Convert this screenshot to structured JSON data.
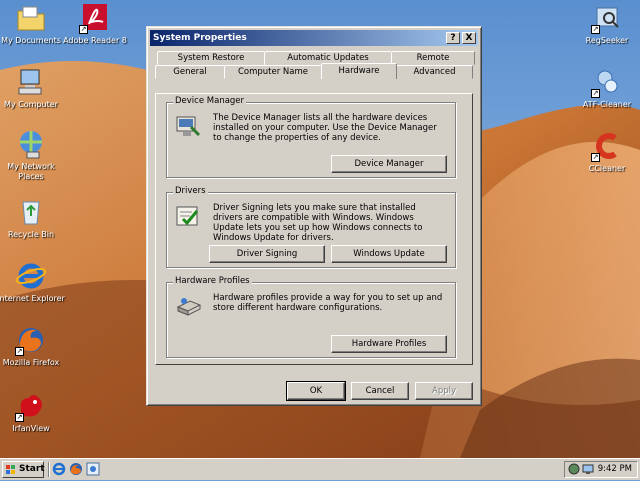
{
  "desktop": {
    "icons": [
      {
        "label": "My Documents"
      },
      {
        "label": "Adobe Reader 8"
      },
      {
        "label": "My Computer"
      },
      {
        "label": "My Network Places"
      },
      {
        "label": "Recycle Bin"
      },
      {
        "label": "Internet Explorer"
      },
      {
        "label": "Mozilla Firefox"
      },
      {
        "label": "IrfanView"
      },
      {
        "label": "RegSeeker"
      },
      {
        "label": "ATF-Cleaner"
      },
      {
        "label": "CCleaner"
      }
    ]
  },
  "window": {
    "title": "System Properties",
    "help_btn": "?",
    "close_btn": "X",
    "tabs_row1": [
      "System Restore",
      "Automatic Updates",
      "Remote"
    ],
    "tabs_row2": [
      "General",
      "Computer Name",
      "Hardware",
      "Advanced"
    ],
    "active_tab": "Hardware",
    "groups": {
      "device_manager": {
        "title": "Device Manager",
        "text": "The Device Manager lists all the hardware devices installed on your computer. Use the Device Manager to change the properties of any device.",
        "button": "Device Manager"
      },
      "drivers": {
        "title": "Drivers",
        "text": "Driver Signing lets you make sure that installed drivers are compatible with Windows. Windows Update lets you set up how Windows connects to Windows Update for drivers.",
        "button1": "Driver Signing",
        "button2": "Windows Update"
      },
      "hardware_profiles": {
        "title": "Hardware Profiles",
        "text": "Hardware profiles provide a way for you to set up and store different hardware configurations.",
        "button": "Hardware Profiles"
      }
    },
    "footer": {
      "ok": "OK",
      "cancel": "Cancel",
      "apply": "Apply"
    }
  },
  "taskbar": {
    "start_label": "Start",
    "clock": "9:42 PM"
  },
  "colors": {
    "titlebar_start": "#0a246a",
    "titlebar_end": "#a6caf0",
    "face": "#d4d0c8"
  }
}
